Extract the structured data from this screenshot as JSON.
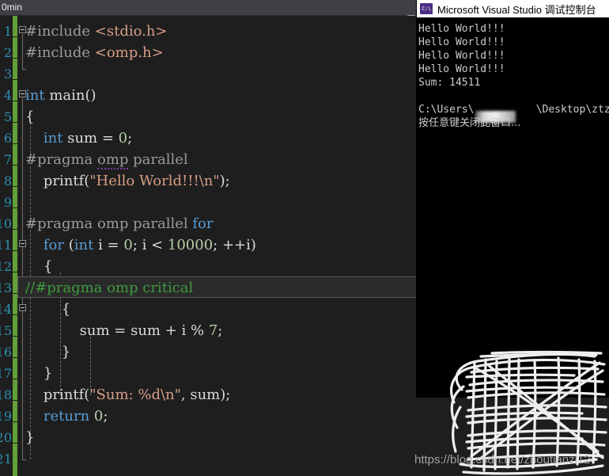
{
  "window": {
    "topbar_label": "0min"
  },
  "editor": {
    "line_numbers": [
      "1",
      "2",
      "3",
      "4",
      "5",
      "6",
      "7",
      "8",
      "9",
      "10",
      "11",
      "12",
      "13",
      "14",
      "15",
      "16",
      "17",
      "18",
      "19",
      "20",
      "21"
    ],
    "lines": [
      {
        "n": "1",
        "segments": [
          {
            "t": "#include ",
            "c": "pp"
          },
          {
            "t": "<stdio.h>",
            "c": "str"
          }
        ]
      },
      {
        "n": "2",
        "segments": [
          {
            "t": "#include ",
            "c": "pp"
          },
          {
            "t": "<omp.h>",
            "c": "str"
          }
        ]
      },
      {
        "n": "3",
        "segments": []
      },
      {
        "n": "4",
        "segments": [
          {
            "t": "int",
            "c": "type"
          },
          {
            "t": " main()",
            "c": "plain"
          }
        ]
      },
      {
        "n": "5",
        "segments": [
          {
            "t": "{",
            "c": "punct"
          }
        ]
      },
      {
        "n": "6",
        "segments": [
          {
            "t": "    ",
            "c": "plain"
          },
          {
            "t": "int",
            "c": "type"
          },
          {
            "t": " sum = ",
            "c": "plain"
          },
          {
            "t": "0",
            "c": "num"
          },
          {
            "t": ";",
            "c": "plain"
          }
        ]
      },
      {
        "n": "7",
        "segments": [
          {
            "t": "#pragma ",
            "c": "pp"
          },
          {
            "t": "omp",
            "c": "pp-squiggle"
          },
          {
            "t": " parallel",
            "c": "pp"
          }
        ]
      },
      {
        "n": "8",
        "segments": [
          {
            "t": "    printf(",
            "c": "plain"
          },
          {
            "t": "\"Hello World!!!\\n\"",
            "c": "str"
          },
          {
            "t": ");",
            "c": "plain"
          }
        ]
      },
      {
        "n": "9",
        "segments": []
      },
      {
        "n": "10",
        "segments": [
          {
            "t": "#pragma omp parallel ",
            "c": "pp"
          },
          {
            "t": "for",
            "c": "kw"
          }
        ]
      },
      {
        "n": "11",
        "segments": [
          {
            "t": "    ",
            "c": "plain"
          },
          {
            "t": "for",
            "c": "kw"
          },
          {
            "t": " (",
            "c": "plain"
          },
          {
            "t": "int",
            "c": "type"
          },
          {
            "t": " i = ",
            "c": "plain"
          },
          {
            "t": "0",
            "c": "num"
          },
          {
            "t": "; i < ",
            "c": "plain"
          },
          {
            "t": "10000",
            "c": "num"
          },
          {
            "t": "; ++i)",
            "c": "plain"
          }
        ]
      },
      {
        "n": "12",
        "segments": [
          {
            "t": "    {",
            "c": "punct"
          }
        ]
      },
      {
        "n": "13",
        "segments": [
          {
            "t": "//#pragma omp critical",
            "c": "cmt"
          }
        ]
      },
      {
        "n": "14",
        "segments": [
          {
            "t": "        {",
            "c": "punct"
          }
        ]
      },
      {
        "n": "15",
        "segments": [
          {
            "t": "            sum = sum + i % ",
            "c": "plain"
          },
          {
            "t": "7",
            "c": "num"
          },
          {
            "t": ";",
            "c": "plain"
          }
        ]
      },
      {
        "n": "16",
        "segments": [
          {
            "t": "        }",
            "c": "punct"
          }
        ]
      },
      {
        "n": "17",
        "segments": [
          {
            "t": "    }",
            "c": "punct"
          }
        ]
      },
      {
        "n": "18",
        "segments": [
          {
            "t": "    printf(",
            "c": "plain"
          },
          {
            "t": "\"Sum: %d\\n\"",
            "c": "str"
          },
          {
            "t": ", sum);",
            "c": "plain"
          }
        ]
      },
      {
        "n": "19",
        "segments": [
          {
            "t": "    ",
            "c": "plain"
          },
          {
            "t": "return",
            "c": "kw"
          },
          {
            "t": " ",
            "c": "plain"
          },
          {
            "t": "0",
            "c": "num"
          },
          {
            "t": ";",
            "c": "plain"
          }
        ]
      },
      {
        "n": "20",
        "segments": [
          {
            "t": "}",
            "c": "punct"
          }
        ]
      }
    ],
    "current_line_index": 12
  },
  "console": {
    "title": "Microsoft Visual Studio 调试控制台",
    "icon_label": "C:\\",
    "lines": [
      "Hello World!!!",
      "Hello World!!!",
      "Hello World!!!",
      "Hello World!!!",
      "Sum: 14511",
      "",
      "C:\\Users\\          \\Desktop\\ztz的vi",
      "按任意键关闭此窗口..."
    ],
    "path_prefix": "C:\\Users",
    "path_suffix": "\\Desktop\\ztz的vi",
    "close_prompt": "按任意键关闭此窗口..."
  },
  "watermark": {
    "text": "https://blog.csdn.net/zhoutianzi12"
  },
  "colors": {
    "editor_bg": "#1e1e1e",
    "topbar_bg": "#3f3f46",
    "change_bar": "#62a038",
    "keyword": "#569cd6",
    "string": "#d69d85",
    "number": "#b5cea8",
    "comment": "#3f9a3f",
    "preprocessor": "#9b9b9b",
    "line_number": "#2b91af",
    "console_bg": "#000000",
    "console_text": "#cccccc"
  }
}
